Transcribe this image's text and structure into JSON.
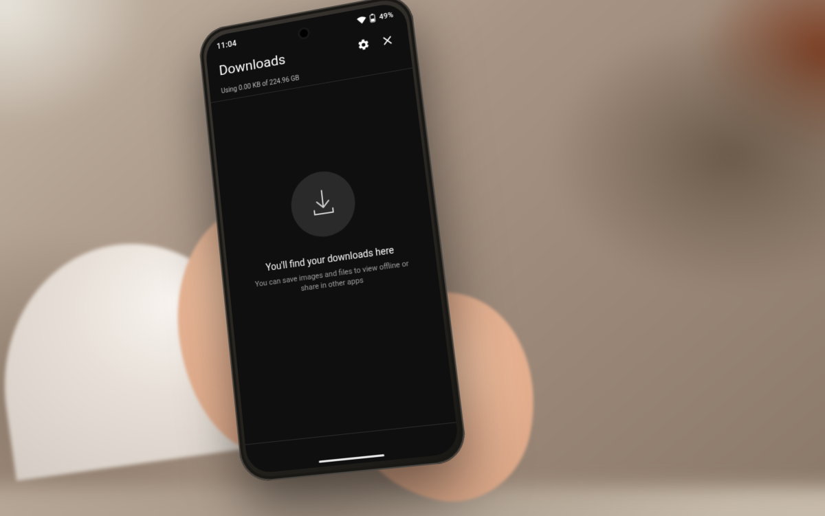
{
  "status": {
    "time": "11:04",
    "battery_text": "49%"
  },
  "header": {
    "title": "Downloads",
    "storage": "Using 0.00 KB of 224.96 GB"
  },
  "empty": {
    "title": "You'll find your downloads here",
    "subtitle": "You can save images and files to view offline or share in other apps"
  }
}
